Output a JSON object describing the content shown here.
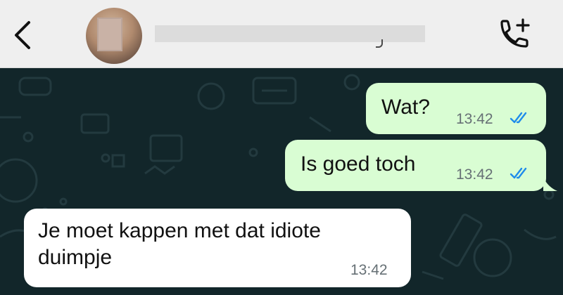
{
  "header": {
    "back_icon": "chevron-left-icon",
    "contact_name": "",
    "call_icon": "phone-plus-icon"
  },
  "messages": [
    {
      "direction": "outgoing",
      "text": "Wat?",
      "time": "13:42",
      "status": "read",
      "status_icon": "double-check-icon"
    },
    {
      "direction": "outgoing",
      "text": "Is goed toch",
      "time": "13:42",
      "status": "read",
      "status_icon": "double-check-icon"
    },
    {
      "direction": "incoming",
      "text": "Je moet kappen met dat idiote duimpje",
      "time": "13:42"
    }
  ],
  "colors": {
    "chat_background": "#12262a",
    "outgoing_bubble": "#d9fdd3",
    "incoming_bubble": "#ffffff",
    "read_ticks": "#1f8ceb",
    "header_background": "#efefef"
  }
}
